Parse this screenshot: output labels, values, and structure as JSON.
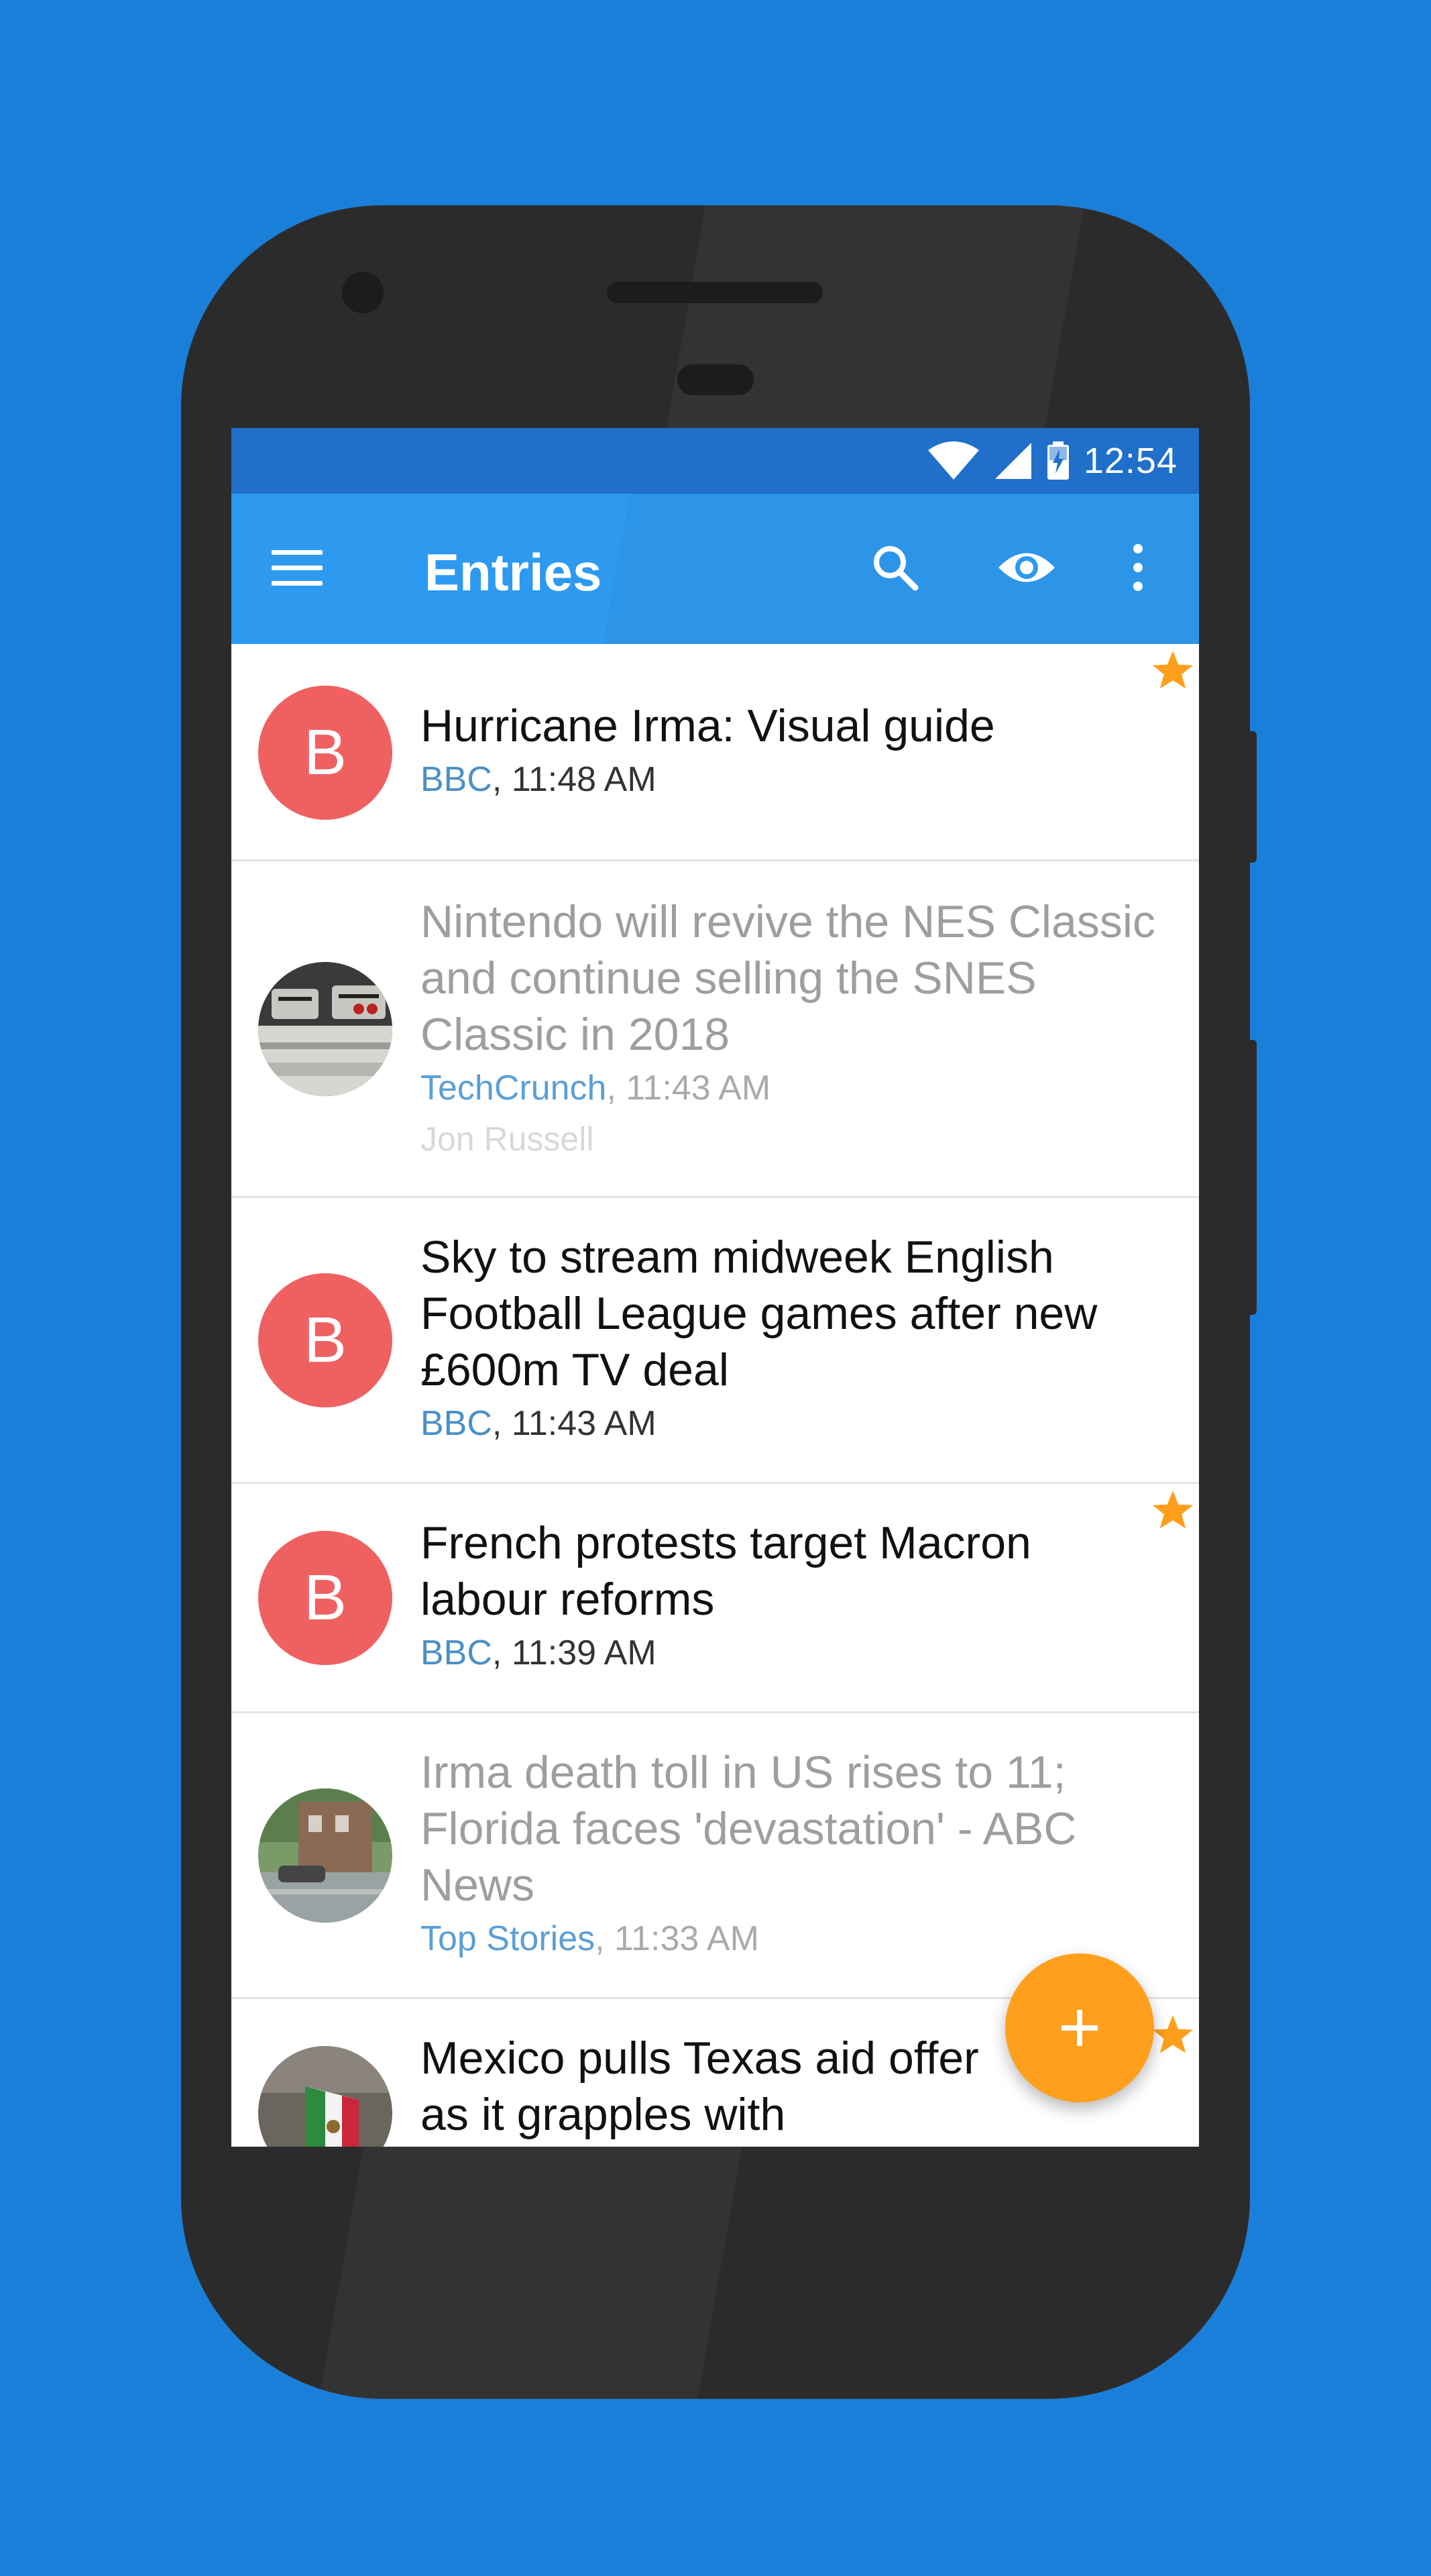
{
  "status_bar": {
    "time": "12:54",
    "icons": [
      "wifi-icon",
      "cellular-signal-icon",
      "battery-charging-icon"
    ]
  },
  "app_bar": {
    "title": "Entries",
    "icons": [
      "menu-icon",
      "search-icon",
      "eye-icon",
      "more-vert-icon"
    ]
  },
  "entries": [
    {
      "title": "Hurricane Irma: Visual guide",
      "source": "BBC",
      "time": ", 11:48 AM",
      "author": "",
      "avatar_letter": "B",
      "starred": true,
      "read": false
    },
    {
      "title": "Nintendo will revive the NES Classic and continue selling the SNES Classic in 2018",
      "source": "TechCrunch",
      "time": ", 11:43 AM",
      "author": "Jon Russell",
      "avatar_letter": "",
      "starred": false,
      "read": true
    },
    {
      "title": "Sky to stream midweek English Football League games after new £600m TV deal",
      "source": "BBC",
      "time": ", 11:43 AM",
      "author": "",
      "avatar_letter": "B",
      "starred": false,
      "read": false
    },
    {
      "title": "French protests target Macron labour reforms",
      "source": "BBC",
      "time": ", 11:39 AM",
      "author": "",
      "avatar_letter": "B",
      "starred": true,
      "read": false
    },
    {
      "title": "Irma death toll in US rises to 11; Florida faces 'devastation' - ABC News",
      "source": "Top Stories",
      "time": ", 11:33 AM",
      "author": "",
      "avatar_letter": "",
      "starred": false,
      "read": true
    },
    {
      "title": "Mexico pulls Texas aid offer as it grapples with earthquake",
      "source": "",
      "time": "",
      "author": "",
      "avatar_letter": "",
      "starred": true,
      "read": false
    }
  ],
  "fab": {
    "icon": "add-icon"
  },
  "colors": {
    "background": "#1a7fd9",
    "status_bar": "#1f6fcb",
    "app_bar": "#2d9af0",
    "avatar": "#ef6161",
    "accent": "#ff9f1c",
    "source_link": "#4a90c8"
  }
}
